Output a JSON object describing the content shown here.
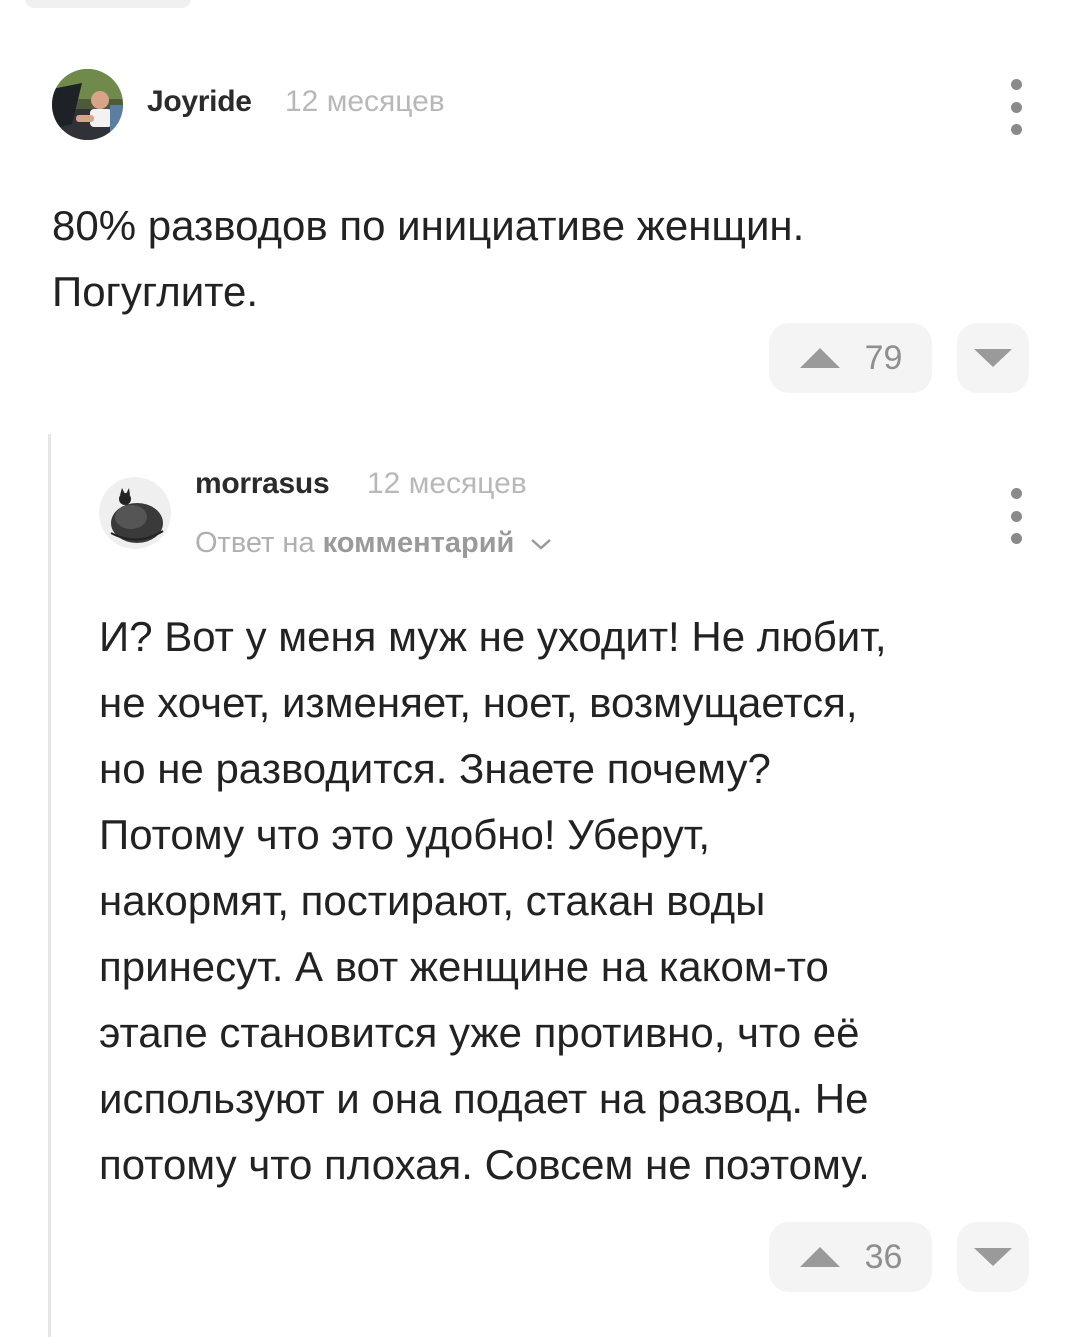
{
  "comments": [
    {
      "author": "Joyride",
      "time": "12 месяцев",
      "text_lines": [
        "80% разводов по инициативе женщин.",
        "Погуглите."
      ],
      "rating": "79"
    },
    {
      "author": "morrasus",
      "time": "12 месяцев",
      "reply_prefix": "Ответ на",
      "reply_link": "комментарий",
      "text_lines": [
        "И? Вот у меня муж не уходит! Не любит,",
        "не хочет, изменяет, ноет, возмущается,",
        "но не разводится. Знаете почему?",
        "Потому что это удобно! Уберут,",
        "накормят, постирают, стакан воды",
        "принесут. А вот женщине на каком-то",
        "этапе становится уже противно, что её",
        "используют и она подает на развод. Не",
        "потому что плохая. Совсем не поэтому."
      ],
      "rating": "36"
    }
  ],
  "icons": {
    "upvote": "triangle-up-icon",
    "downvote": "triangle-down-icon",
    "more": "more-vertical-icon",
    "reply_expand": "chevron-down-icon"
  },
  "colors": {
    "text": "#222222",
    "muted": "#b8b8b8",
    "button_bg": "#f4f4f4",
    "icon": "#9a9a9a"
  }
}
